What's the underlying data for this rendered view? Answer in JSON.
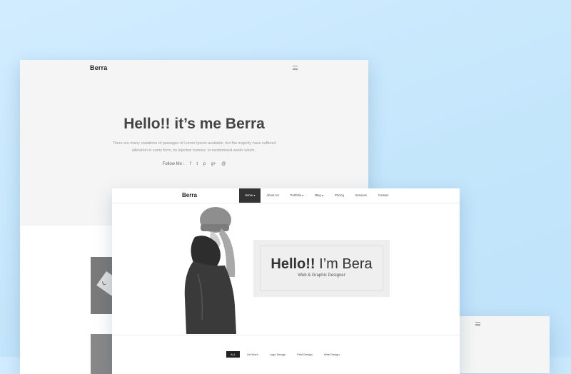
{
  "back_page": {
    "logo": "Berra",
    "hero_title": "Hello!! it’s me Berra",
    "hero_text": "There are many variations of passages of Lorem Ipsum available, but the majority have suffered alteration in some form, by injected humour, or randomised words which..",
    "follow_label": "Follow Me :",
    "social_icons": [
      "f",
      "t",
      "p",
      "g+",
      "@"
    ]
  },
  "front_page": {
    "logo": "Berra",
    "nav": [
      {
        "label": "Home ▾",
        "active": true
      },
      {
        "label": "About Us"
      },
      {
        "label": "Portfolio ▾"
      },
      {
        "label": "Blog ▾"
      },
      {
        "label": "Pricing"
      },
      {
        "label": "Services"
      },
      {
        "label": "Contact"
      }
    ],
    "hero_title_bold": "Hello!!",
    "hero_title_rest": " I’m Bera",
    "hero_subtitle": "Web & Graphic Designer",
    "filters": [
      "ALL",
      "Art Work",
      "Logo Design",
      "Print Design",
      "Web Design"
    ]
  },
  "icons": {
    "menu": "hamburger-icon",
    "social": [
      "facebook-icon",
      "twitter-icon",
      "pinterest-icon",
      "google-plus-icon",
      "dribbble-icon"
    ]
  }
}
